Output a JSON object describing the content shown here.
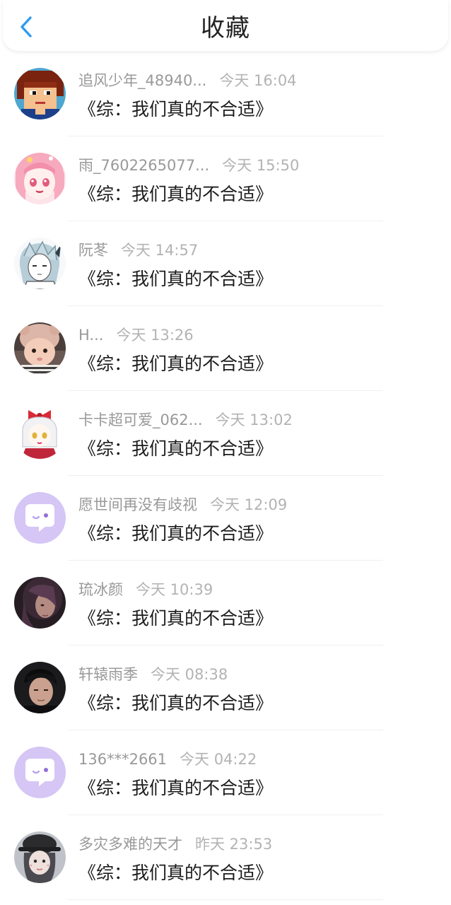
{
  "header": {
    "title": "收藏",
    "back_icon": "chevron-left-icon",
    "accent_color": "#2f9bf0"
  },
  "items": [
    {
      "name": "追风少年_48940...",
      "time": "今天 16:04",
      "message": "《综：我们真的不合适》",
      "avatar": "pixel-boy"
    },
    {
      "name": "雨_7602265077...",
      "time": "今天 15:50",
      "message": "《综：我们真的不合适》",
      "avatar": "anime-pink"
    },
    {
      "name": "阮苳",
      "time": "今天 14:57",
      "message": "《综：我们真的不合适》",
      "avatar": "sketch-girl"
    },
    {
      "name": "H...",
      "time": "今天 13:26",
      "message": "《综：我们真的不合适》",
      "avatar": "baby-hat"
    },
    {
      "name": "卡卡超可爱_062...",
      "time": "今天 13:02",
      "message": "《综：我们真的不合适》",
      "avatar": "bow-girl"
    },
    {
      "name": "愿世间再没有歧视",
      "time": "今天 12:09",
      "message": "《综：我们真的不合适》",
      "avatar": "default-chat"
    },
    {
      "name": "琉冰颜",
      "time": "今天 10:39",
      "message": "《综：我们真的不合适》",
      "avatar": "dark-portrait"
    },
    {
      "name": "轩辕雨季",
      "time": "今天 08:38",
      "message": "《综：我们真的不合适》",
      "avatar": "boy-portrait"
    },
    {
      "name": "136***2661",
      "time": "今天 04:22",
      "message": "《综：我们真的不合适》",
      "avatar": "default-chat"
    },
    {
      "name": "多灾多难的天才",
      "time": "昨天 23:53",
      "message": "《综：我们真的不合适》",
      "avatar": "hat-girl"
    }
  ]
}
